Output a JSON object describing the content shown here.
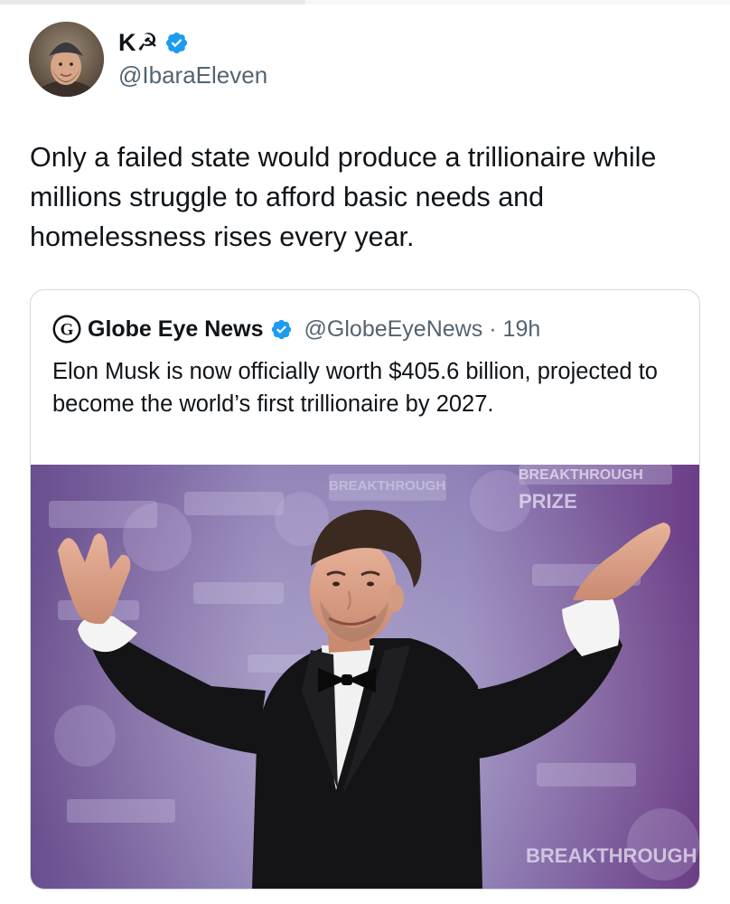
{
  "tweet": {
    "author": {
      "name": "K☭",
      "handle": "@IbaraEleven",
      "verified": true,
      "avatar_icon": "profile-photo-man-beanie"
    },
    "text": "Only a failed state would produce a trillionaire while millions struggle to afford basic needs and homelessness rises every year."
  },
  "quoted_tweet": {
    "author": {
      "name": "Globe Eye News",
      "handle": "@GlobeEyeNews",
      "verified": true,
      "logo_icon": "globe-eye-g-logo"
    },
    "separator": "·",
    "time": "19h",
    "text": "Elon Musk is now officially worth $405.6 billion, projected to become the world’s first trillionaire by 2027.",
    "media": {
      "subject": "photo-man-tuxedo-arms-outstretched",
      "backdrop_text": [
        "BREAKTHROUGH",
        "PRIZE"
      ]
    }
  },
  "colors": {
    "text": "#0f1419",
    "secondary": "#536471",
    "verified": "#1d9bf0",
    "border": "#cfd9de",
    "backdrop": "#7a5a9c"
  }
}
